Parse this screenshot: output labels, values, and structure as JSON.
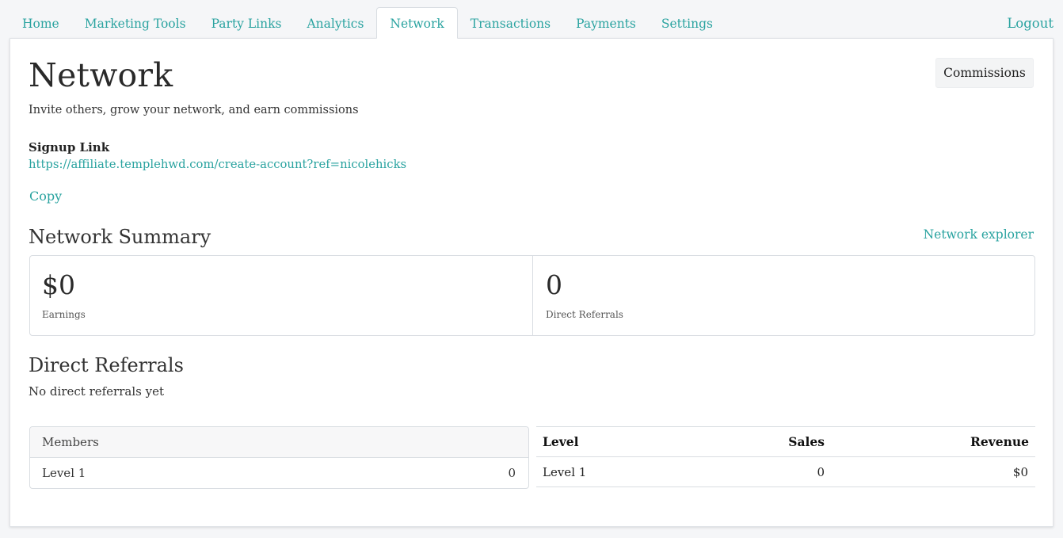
{
  "nav": {
    "tabs": [
      {
        "label": "Home"
      },
      {
        "label": "Marketing Tools"
      },
      {
        "label": "Party Links"
      },
      {
        "label": "Analytics"
      },
      {
        "label": "Network"
      },
      {
        "label": "Transactions"
      },
      {
        "label": "Payments"
      },
      {
        "label": "Settings"
      }
    ],
    "active_tab": "Network",
    "logout_label": "Logout"
  },
  "page": {
    "title": "Network",
    "subtitle": "Invite others, grow your network, and earn commissions",
    "commissions_label": "Commissions"
  },
  "signup": {
    "label": "Signup Link",
    "url": "https://affiliate.templehwd.com/create-account?ref=nicolehicks",
    "copy_label": "Copy"
  },
  "summary": {
    "title": "Network Summary",
    "explorer_label": "Network explorer",
    "earnings_value": "$0",
    "earnings_label": "Earnings",
    "referrals_value": "0",
    "referrals_label": "Direct Referrals"
  },
  "direct_referrals": {
    "title": "Direct Referrals",
    "empty_message": "No direct referrals yet"
  },
  "members_table": {
    "header": "Members",
    "rows": [
      {
        "level": "Level 1",
        "count": "0"
      }
    ]
  },
  "levels_table": {
    "headers": {
      "level": "Level",
      "sales": "Sales",
      "revenue": "Revenue"
    },
    "rows": [
      {
        "level": "Level 1",
        "sales": "0",
        "revenue": "$0"
      }
    ]
  },
  "colors": {
    "accent": "#2aa3a0",
    "border": "#d9dde2",
    "background": "#f5f6f8"
  }
}
